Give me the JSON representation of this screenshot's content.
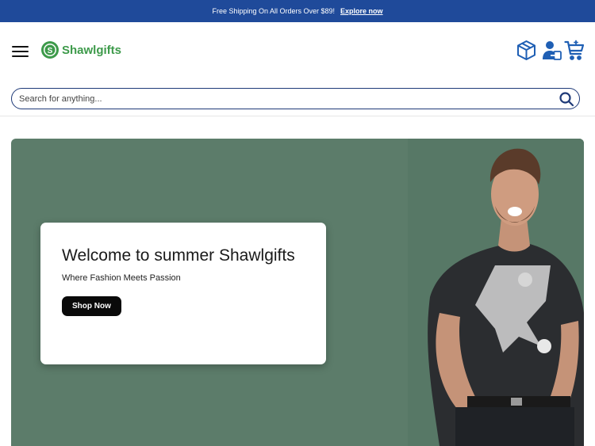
{
  "announcement": {
    "text": "Free Shipping On All Orders Over $89!",
    "link_label": "Explore now"
  },
  "header": {
    "brand_name": "Shawlgifts",
    "logo_letter": "S",
    "icons": [
      "package-icon",
      "user-login-icon",
      "cart-icon"
    ]
  },
  "search": {
    "placeholder": "Search for anything..."
  },
  "hero": {
    "title": "Welcome to summer Shawlgifts",
    "subtitle": "Where Fashion Meets Passion",
    "button_label": "Shop Now"
  },
  "colors": {
    "announcement_bg": "#1f4a9a",
    "brand_green": "#3d9a4a",
    "hero_bg": "#5c7c6a",
    "icon_blue": "#1f5fb4"
  }
}
